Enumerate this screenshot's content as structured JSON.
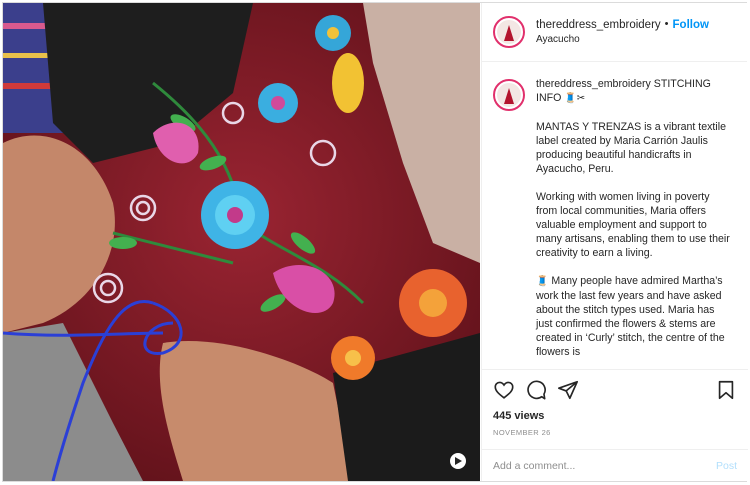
{
  "post": {
    "username": "thereddress_embroidery",
    "follow_label": "Follow",
    "location": "Ayacucho"
  },
  "caption": {
    "username": "thereddress_embroidery",
    "heading": "STITCHING INFO",
    "heading_emoji": "🧵✂",
    "para1": "MANTAS Y TRENZAS is a vibrant textile label created by Maria Carrión Jaulis producing beautiful handicrafts in Ayacucho, Peru.",
    "para2": "Working with women living in poverty from local communities, Maria offers valuable employment and support to many artisans, enabling them to use their creativity to earn a living.",
    "para3_emoji": "🧵",
    "para3": " Many people have admired Martha’s work the last few years and have asked about the stitch types used. Maria has just confirmed the flowers & stems are created in ‘Curly’ stitch, the centre of the flowers is"
  },
  "stats": {
    "views": "445 views",
    "date": "NOVEMBER 26"
  },
  "comment_box": {
    "placeholder": "Add a comment...",
    "post_label": "Post"
  },
  "icons": [
    "heart-icon",
    "comment-icon",
    "share-icon",
    "bookmark-icon",
    "video-icon"
  ],
  "colors": {
    "fabric_red": "#7c1b25",
    "follow_blue": "#0095f6",
    "post_disabled": "#b2dffc",
    "story_ring": "#e1306c"
  }
}
